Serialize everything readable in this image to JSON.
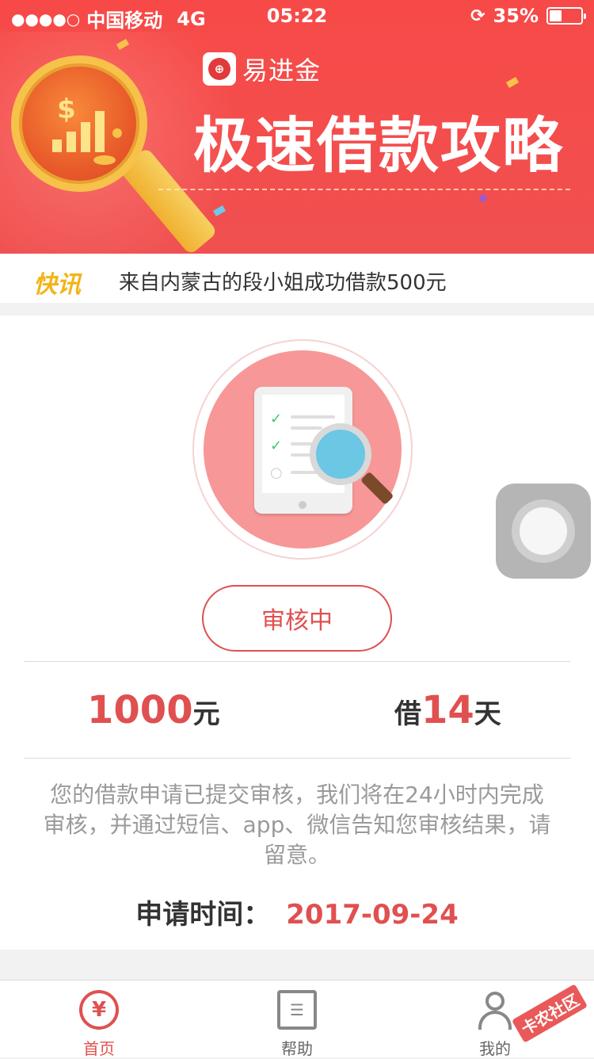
{
  "status_bar": {
    "signal": "●●●●○",
    "carrier": "中国移动",
    "network": "4G",
    "time": "05:22",
    "battery": "35%",
    "battery_level": 0.35
  },
  "banner": {
    "brand_name": "易进金",
    "title": "极速借款攻略"
  },
  "ticker": {
    "tag": "快讯",
    "text": "来自内蒙古的段小姐成功借款500元"
  },
  "loan": {
    "status_label": "审核中",
    "amount": "1000",
    "amount_unit": "元",
    "term_prefix": "借",
    "term_days": "14",
    "term_unit": "天",
    "notice": "您的借款申请已提交审核，我们将在24小时内完成审核，并通过短信、app、微信告知您审核结果，请留意。",
    "apply_time_label": "申请时间：",
    "apply_time_value": "2017-09-24"
  },
  "tabbar": {
    "tabs": [
      {
        "label": "首页",
        "icon": "home-yuan-icon",
        "active": true
      },
      {
        "label": "帮助",
        "icon": "book-icon",
        "active": false
      },
      {
        "label": "我的",
        "icon": "user-icon",
        "active": false
      }
    ]
  },
  "watermark": "卡农社区",
  "colors": {
    "accent": "#e05050",
    "banner": "#f74a48",
    "ticker_tag": "#f2b418"
  }
}
